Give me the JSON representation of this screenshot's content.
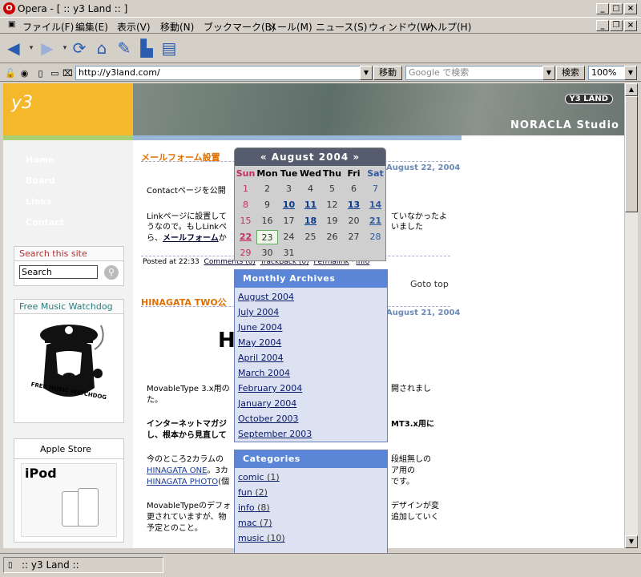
{
  "window": {
    "title": "Opera - [ :: y3 Land :: ]"
  },
  "menu": [
    "ファイル(F)",
    "編集(E)",
    "表示(V)",
    "移動(N)",
    "ブックマーク(B)",
    "メール(M)",
    "ニュース(S)",
    "ウィンドウ(W)",
    "ヘルプ(H)"
  ],
  "address": {
    "url": "http://y3land.com/",
    "go_label": "移動",
    "search_placeholder": "Google で検索",
    "search_label": "検索",
    "zoom": "100%"
  },
  "site": {
    "logo": "y3",
    "banner_badge": "Y3 LAND",
    "banner_title": "NORACLA Studio",
    "nav": [
      "Home",
      "Board",
      "Links",
      "Contact"
    ],
    "search_box": {
      "title": "Search this site",
      "value": "Search"
    },
    "music_box": {
      "title": "Free Music Watchdog",
      "caption": "FREE MUSIC WATCHDOG"
    },
    "apple_box": {
      "title": "Apple Store",
      "product": "iPod"
    }
  },
  "posts": [
    {
      "title": "メールフォーム設置",
      "date": "August 22, 2004",
      "line1": "Contactページを公開",
      "line2": "Linkページに設置して",
      "line2b": "ていなかったよ",
      "line3": "うなので。もしLinkペ",
      "line3b": "いました",
      "line4a": "ら、",
      "line4link": "メールフォーム",
      "line4b": "か",
      "footer": {
        "posted": "Posted at 22:33",
        "comments": "Comments (0)",
        "trackback": "TrackBack (0)",
        "permalink": "Permalink",
        "category": "info"
      }
    },
    {
      "title": "HINAGATA TWO公",
      "date": "August 21, 2004",
      "heading": "H",
      "p1a": "MovableType 3.x用の",
      "p1b": "開されまし",
      "p1c": "た。",
      "p2a": "インターネットマガジ",
      "p2b": "MT3.x用に",
      "p2c": "し、根本から見直して",
      "p3a": "今のところ2カラムの",
      "p3b": "段組無しの",
      "p3link1": "HINAGATA ONE",
      "p3c": "。3カ",
      "p3d": "ア用の",
      "p3link2": "HINAGATA PHOTO",
      "p3e": "(個",
      "p3f": "です。",
      "p4a": "MovableTypeのデフォ",
      "p4b": "デザインが変",
      "p4c": "更されていますが、物",
      "p4d": "追加していく",
      "p4e": "予定とのこと。"
    }
  ],
  "goto_top": "Goto top",
  "calendar": {
    "title": "August 2004",
    "prev": "«",
    "next": "»",
    "dow": [
      "Sun",
      "Mon",
      "Tue",
      "Wed",
      "Thu",
      "Fri",
      "Sat"
    ],
    "weeks": [
      [
        "1",
        "2",
        "3",
        "4",
        "5",
        "6",
        "7"
      ],
      [
        "8",
        "9",
        "10",
        "11",
        "12",
        "13",
        "14"
      ],
      [
        "15",
        "16",
        "17",
        "18",
        "19",
        "20",
        "21"
      ],
      [
        "22",
        "23",
        "24",
        "25",
        "26",
        "27",
        "28"
      ],
      [
        "29",
        "30",
        "31",
        "",
        "",
        "",
        ""
      ]
    ],
    "linked": [
      "10",
      "11",
      "13",
      "14",
      "18",
      "21",
      "22"
    ],
    "today": "23"
  },
  "archives": {
    "title": "Monthly Archives",
    "items": [
      "August 2004",
      "July 2004",
      "June 2004",
      "May 2004",
      "April 2004",
      "March 2004",
      "February 2004",
      "January 2004",
      "October 2003",
      "September 2003"
    ]
  },
  "categories": {
    "title": "Categories",
    "items": [
      {
        "name": "comic",
        "count": "(1)"
      },
      {
        "name": "fun",
        "count": "(2)"
      },
      {
        "name": "info",
        "count": "(8)"
      },
      {
        "name": "mac",
        "count": "(7)"
      },
      {
        "name": "music",
        "count": "(10)"
      }
    ]
  },
  "status": {
    "text": ":: y3 Land ::"
  }
}
